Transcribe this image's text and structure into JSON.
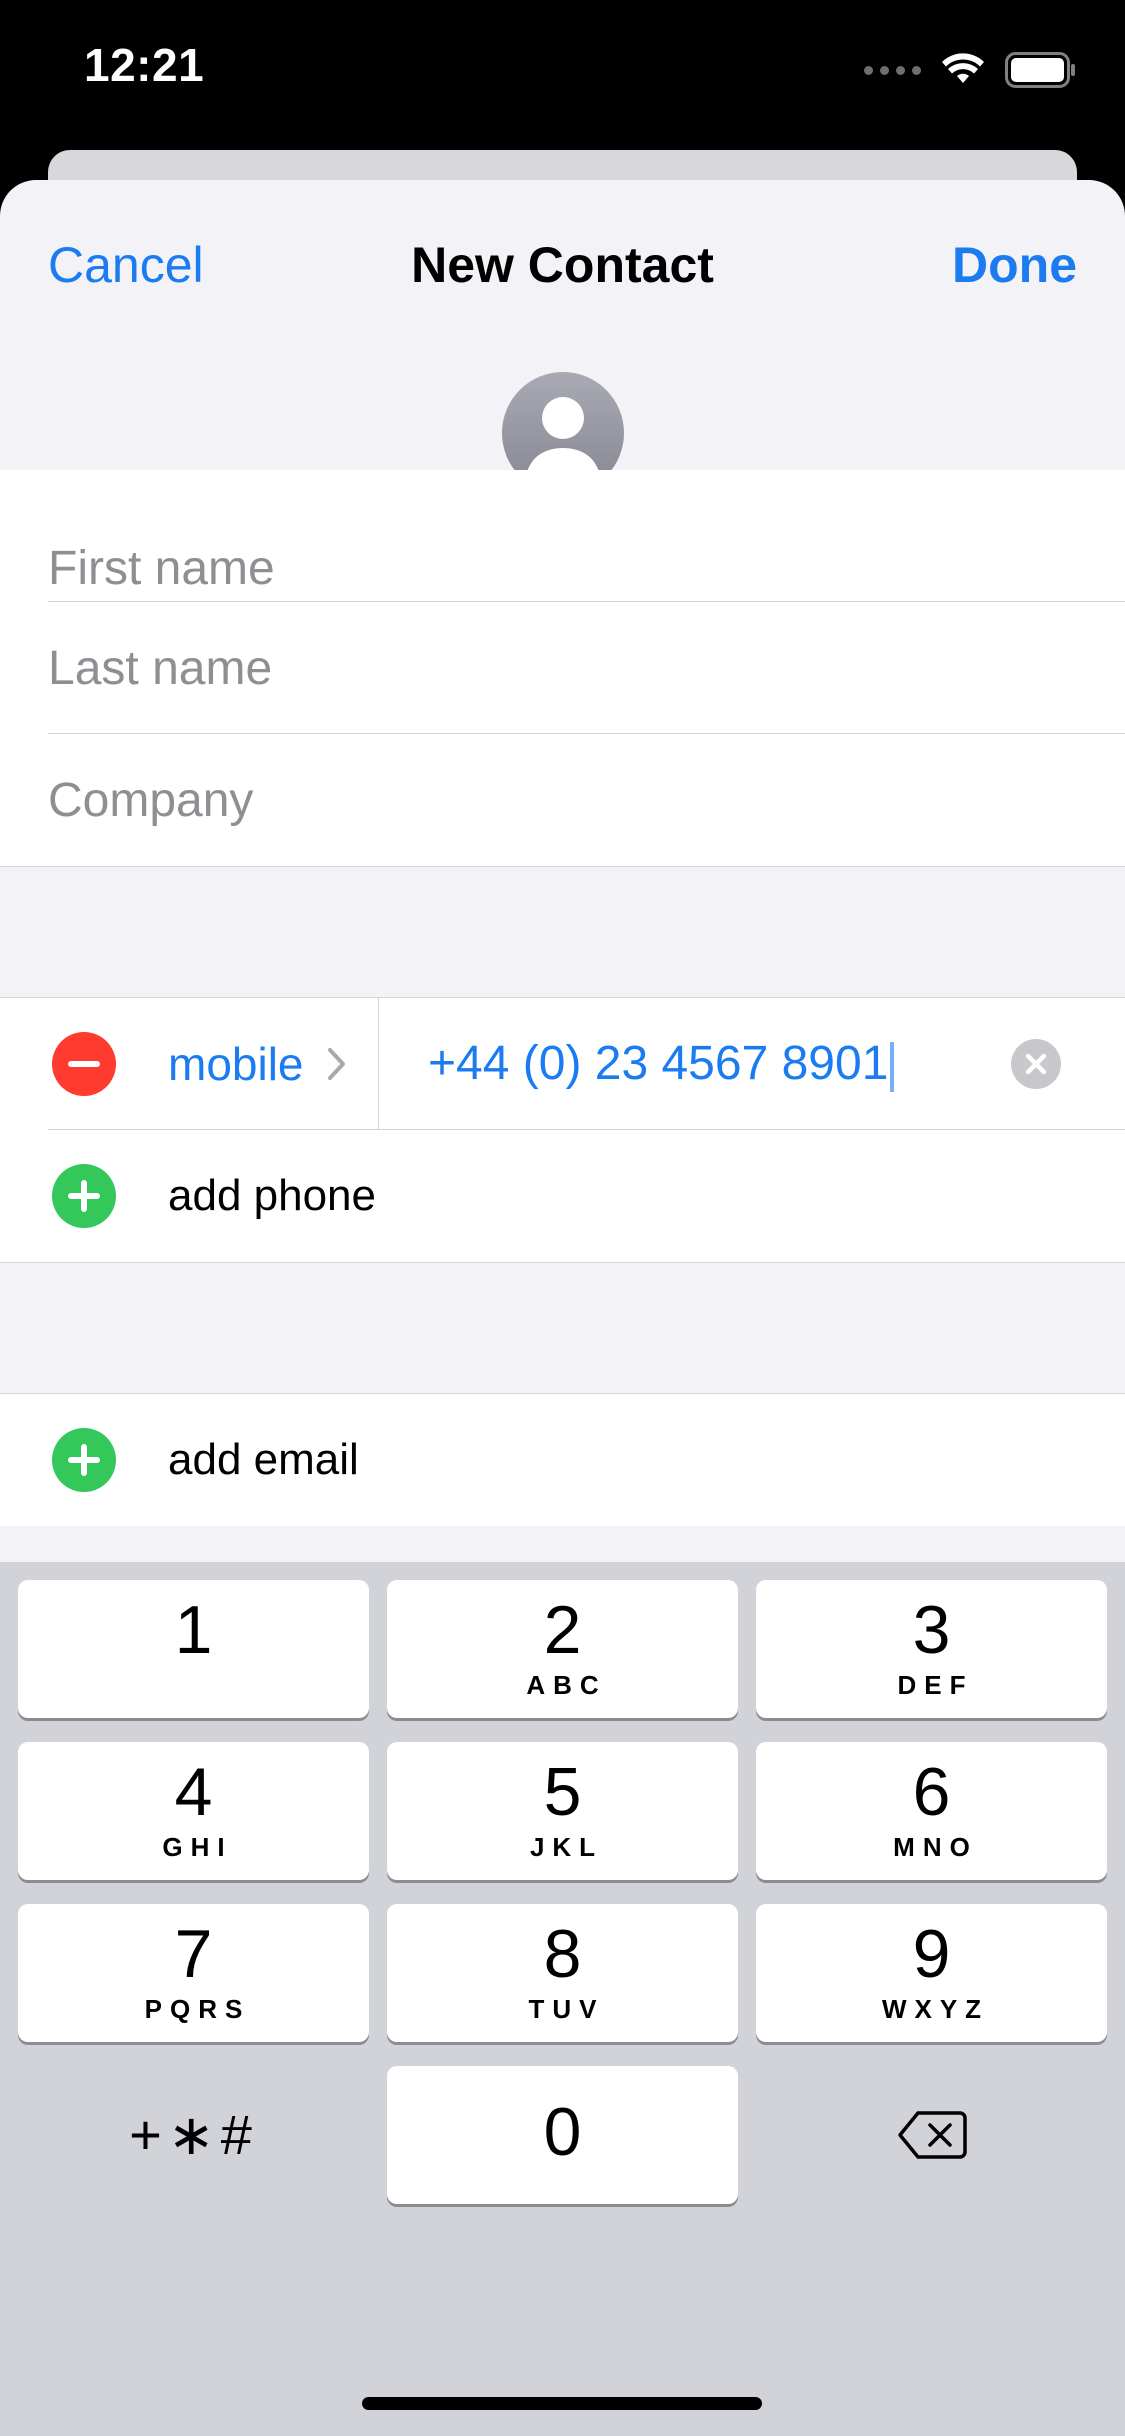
{
  "status_bar": {
    "time": "12:21"
  },
  "nav": {
    "cancel_label": "Cancel",
    "title": "New Contact",
    "done_label": "Done"
  },
  "name_fields": {
    "first_name_placeholder": "First name",
    "last_name_placeholder": "Last name",
    "company_placeholder": "Company"
  },
  "phone": {
    "label": "mobile",
    "value": "+44 (0) 23 4567 8901",
    "add_label": "add phone"
  },
  "email": {
    "add_label": "add email"
  },
  "keyboard": {
    "keys": [
      {
        "digit": "1",
        "letters": ""
      },
      {
        "digit": "2",
        "letters": "ABC"
      },
      {
        "digit": "3",
        "letters": "DEF"
      },
      {
        "digit": "4",
        "letters": "GHI"
      },
      {
        "digit": "5",
        "letters": "JKL"
      },
      {
        "digit": "6",
        "letters": "MNO"
      },
      {
        "digit": "7",
        "letters": "PQRS"
      },
      {
        "digit": "8",
        "letters": "TUV"
      },
      {
        "digit": "9",
        "letters": "WXYZ"
      },
      {
        "digit": "0",
        "letters": ""
      }
    ],
    "symbols_label": "+∗#"
  },
  "colors": {
    "accent": "#1a7cf0",
    "delete": "#ff3b30",
    "add": "#34c759"
  }
}
